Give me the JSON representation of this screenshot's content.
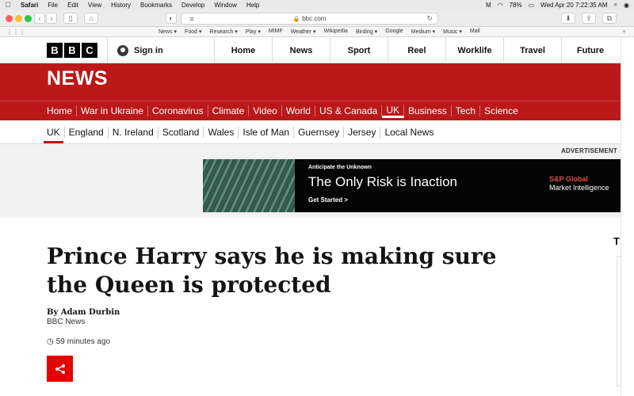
{
  "menubar": {
    "apple": "",
    "items": [
      "Safari",
      "File",
      "Edit",
      "View",
      "History",
      "Bookmarks",
      "Develop",
      "Window",
      "Help"
    ],
    "battery": "78%",
    "clock": "Wed Apr 20  7:22:35 AM"
  },
  "browser": {
    "url": "bbc.com",
    "favorites": [
      "News ▾",
      "Food ▾",
      "Research ▾",
      "Play ▾",
      "MIMF",
      "Weather ▾",
      "Wikipedia",
      "Birding ▾",
      "Google",
      "Medium ▾",
      "Music ▾",
      "Mail"
    ]
  },
  "bbc": {
    "logo": [
      "B",
      "B",
      "C"
    ],
    "signin": "Sign in",
    "topnav": [
      "Home",
      "News",
      "Sport",
      "Reel",
      "Worklife",
      "Travel",
      "Future"
    ]
  },
  "news": {
    "title": "NEWS",
    "nav": [
      "Home",
      "War in Ukraine",
      "Coronavirus",
      "Climate",
      "Video",
      "World",
      "US & Canada",
      "UK",
      "Business",
      "Tech",
      "Science"
    ],
    "active": "UK",
    "subnav": [
      "UK",
      "England",
      "N. Ireland",
      "Scotland",
      "Wales",
      "Isle of Man",
      "Guernsey",
      "Jersey",
      "Local News"
    ]
  },
  "advert": {
    "label": "ADVERTISEMENT",
    "eyebrow": "Anticipate the Unknown",
    "headline": "The Only Risk is Inaction",
    "cta": "Get Started >",
    "brand": "S&P Global",
    "brand_sub": "Market Intelligence"
  },
  "article": {
    "headline": "Prince Harry says he is making sure the Queen is protected",
    "author": "By Adam Durbin",
    "org": "BBC News",
    "time": "59 minutes ago"
  },
  "sidebar": {
    "letter": "T"
  },
  "colors": {
    "news_red": "#bb1919",
    "share_red": "#e60000"
  }
}
